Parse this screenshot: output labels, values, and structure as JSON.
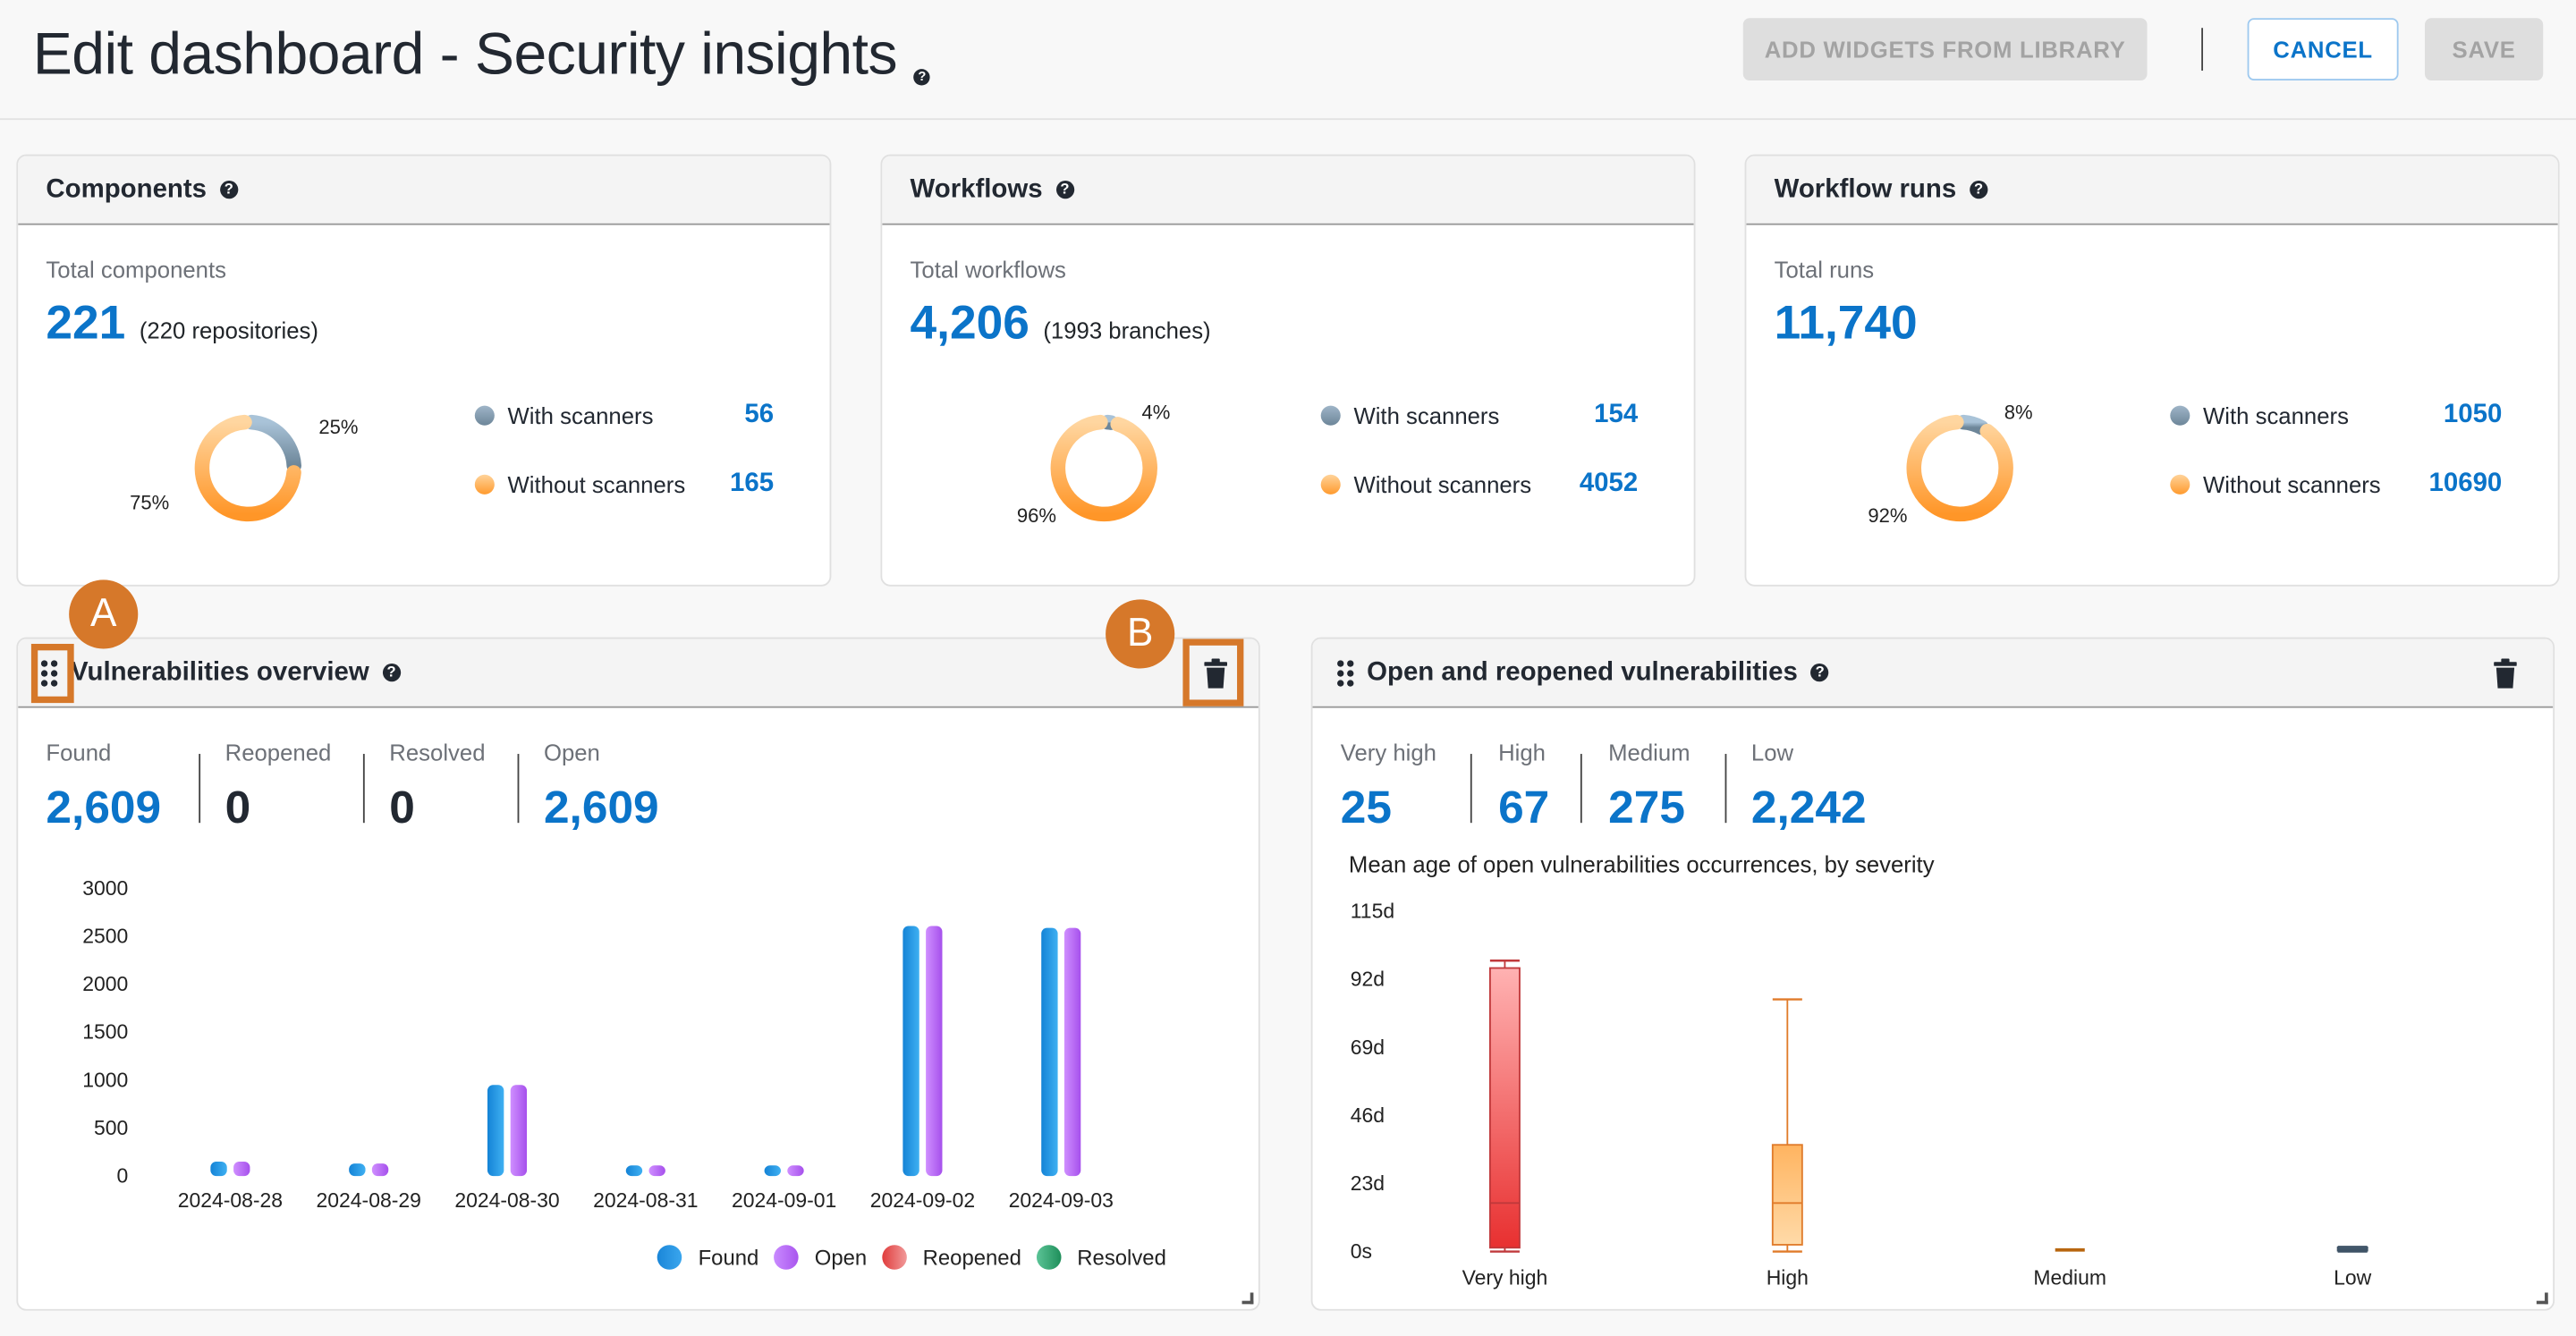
{
  "header": {
    "title": "Edit dashboard - Security insights",
    "add_widgets_label": "ADD WIDGETS FROM LIBRARY",
    "cancel_label": "CANCEL",
    "save_label": "SAVE"
  },
  "colors": {
    "accent": "#0b74c9",
    "with_scanners": "#6d8699",
    "without_scanners": "#ff9a2e",
    "found": "#1e90e0",
    "open": "#b564f5",
    "reopened": "#e84545",
    "resolved": "#2e9e6a",
    "annotation": "#d6782a"
  },
  "summary_cards": [
    {
      "title": "Components",
      "total_label": "Total components",
      "total_value": "221",
      "total_suffix": "(220 repositories)",
      "with_label": "With scanners",
      "with_value": "56",
      "without_label": "Without scanners",
      "without_value": "165",
      "with_pct_label": "25%",
      "without_pct_label": "75%"
    },
    {
      "title": "Workflows",
      "total_label": "Total workflows",
      "total_value": "4,206",
      "total_suffix": "(1993 branches)",
      "with_label": "With scanners",
      "with_value": "154",
      "without_label": "Without scanners",
      "without_value": "4052",
      "with_pct_label": "4%",
      "without_pct_label": "96%"
    },
    {
      "title": "Workflow runs",
      "total_label": "Total runs",
      "total_value": "11,740",
      "total_suffix": "",
      "with_label": "With scanners",
      "with_value": "1050",
      "without_label": "Without scanners",
      "without_value": "10690",
      "with_pct_label": "8%",
      "without_pct_label": "92%"
    }
  ],
  "vuln_overview": {
    "title": "Vulnerabilities overview",
    "annotation_a": "A",
    "annotation_b": "B",
    "stats": [
      {
        "label": "Found",
        "value": "2,609"
      },
      {
        "label": "Reopened",
        "value": "0"
      },
      {
        "label": "Resolved",
        "value": "0"
      },
      {
        "label": "Open",
        "value": "2,609"
      }
    ]
  },
  "open_reopened": {
    "title": "Open and reopened vulnerabilities",
    "stats": [
      {
        "label": "Very high",
        "value": "25"
      },
      {
        "label": "High",
        "value": "67"
      },
      {
        "label": "Medium",
        "value": "275"
      },
      {
        "label": "Low",
        "value": "2,242"
      }
    ],
    "chart_title": "Mean age of open vulnerabilities occurrences, by severity"
  },
  "chart_data": [
    {
      "type": "pie",
      "title": "Components",
      "categories": [
        "With scanners",
        "Without scanners"
      ],
      "values": [
        56,
        165
      ],
      "labels": [
        "25%",
        "75%"
      ]
    },
    {
      "type": "pie",
      "title": "Workflows",
      "categories": [
        "With scanners",
        "Without scanners"
      ],
      "values": [
        154,
        4052
      ],
      "labels": [
        "4%",
        "96%"
      ]
    },
    {
      "type": "pie",
      "title": "Workflow runs",
      "categories": [
        "With scanners",
        "Without scanners"
      ],
      "values": [
        1050,
        10690
      ],
      "labels": [
        "8%",
        "92%"
      ]
    },
    {
      "type": "bar",
      "title": "Vulnerabilities overview",
      "categories": [
        "2024-08-28",
        "2024-08-29",
        "2024-08-30",
        "2024-08-31",
        "2024-09-01",
        "2024-09-02",
        "2024-09-03"
      ],
      "series": [
        {
          "name": "Found",
          "values": [
            150,
            130,
            950,
            110,
            110,
            2609,
            2590
          ]
        },
        {
          "name": "Open",
          "values": [
            150,
            130,
            950,
            110,
            110,
            2609,
            2590
          ]
        },
        {
          "name": "Reopened",
          "values": [
            0,
            0,
            0,
            0,
            0,
            0,
            0
          ]
        },
        {
          "name": "Resolved",
          "values": [
            0,
            0,
            0,
            0,
            0,
            0,
            0
          ]
        }
      ],
      "yticks": [
        "0",
        "500",
        "1000",
        "1500",
        "2000",
        "2500",
        "3000"
      ],
      "ylim": [
        0,
        3000
      ],
      "xlabel": "",
      "ylabel": "",
      "legend": "bottom-right"
    },
    {
      "type": "box",
      "title": "Mean age of open vulnerabilities occurrences, by severity",
      "categories": [
        "Very high",
        "High",
        "Medium",
        "Low"
      ],
      "unit": "days",
      "boxes": [
        {
          "name": "Very high",
          "min": 0,
          "q1": 1.3,
          "median": 16.4,
          "q3": 95.9,
          "max": 98.4
        },
        {
          "name": "High",
          "min": 0,
          "q1": 2.3,
          "median": 16.4,
          "q3": 36.1,
          "max": 85.3
        },
        {
          "name": "Medium",
          "min": 0,
          "q1": 0,
          "median": 0,
          "q3": 0,
          "max": 0
        },
        {
          "name": "Low",
          "min": 0,
          "q1": 0.3,
          "median": 0.8,
          "q3": 1.4,
          "max": 1.6
        }
      ],
      "yticks": [
        "0s",
        "23d",
        "46d",
        "69d",
        "92d",
        "115d"
      ],
      "ylim": [
        0,
        115
      ]
    }
  ]
}
